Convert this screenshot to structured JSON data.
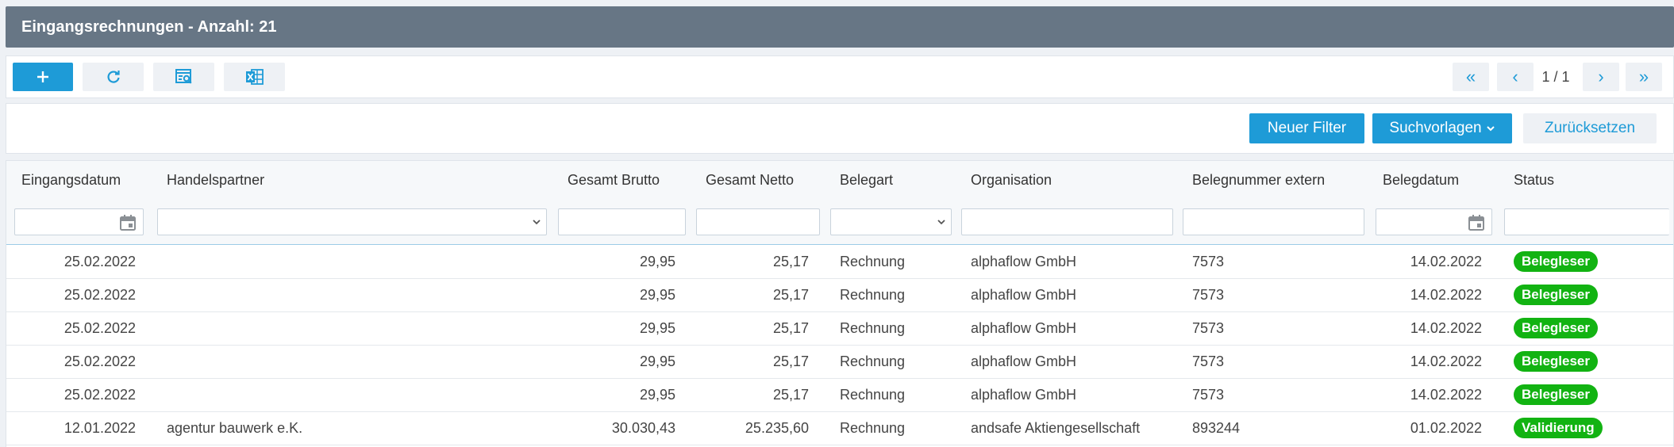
{
  "header": {
    "title": "Eingangsrechnungen - Anzahl: 21"
  },
  "toolbar": {
    "buttons": [
      {
        "name": "add",
        "icon": "plus-icon"
      },
      {
        "name": "refresh",
        "icon": "refresh-icon"
      },
      {
        "name": "search-preview",
        "icon": "search-document-icon"
      },
      {
        "name": "excel-export",
        "icon": "excel-icon"
      }
    ],
    "pager": {
      "first": "«",
      "prev": "‹",
      "label": "1 / 1",
      "next": "›",
      "last": "»"
    }
  },
  "filterbar": {
    "new_filter": "Neuer Filter",
    "templates": "Suchvorlagen",
    "reset": "Zurücksetzen"
  },
  "table": {
    "columns": [
      "Eingangsdatum",
      "Handelspartner",
      "Gesamt Brutto",
      "Gesamt Netto",
      "Belegart",
      "Organisation",
      "Belegnummer extern",
      "Belegdatum",
      "Status"
    ],
    "rows": [
      {
        "eingang": "25.02.2022",
        "partner": "",
        "brutto": "29,95",
        "netto": "25,17",
        "belegart": "Rechnung",
        "org": "alphaflow GmbH",
        "nr": "7573",
        "belegdatum": "14.02.2022",
        "status": "Belegleser"
      },
      {
        "eingang": "25.02.2022",
        "partner": "",
        "brutto": "29,95",
        "netto": "25,17",
        "belegart": "Rechnung",
        "org": "alphaflow GmbH",
        "nr": "7573",
        "belegdatum": "14.02.2022",
        "status": "Belegleser"
      },
      {
        "eingang": "25.02.2022",
        "partner": "",
        "brutto": "29,95",
        "netto": "25,17",
        "belegart": "Rechnung",
        "org": "alphaflow GmbH",
        "nr": "7573",
        "belegdatum": "14.02.2022",
        "status": "Belegleser"
      },
      {
        "eingang": "25.02.2022",
        "partner": "",
        "brutto": "29,95",
        "netto": "25,17",
        "belegart": "Rechnung",
        "org": "alphaflow GmbH",
        "nr": "7573",
        "belegdatum": "14.02.2022",
        "status": "Belegleser"
      },
      {
        "eingang": "25.02.2022",
        "partner": "",
        "brutto": "29,95",
        "netto": "25,17",
        "belegart": "Rechnung",
        "org": "alphaflow GmbH",
        "nr": "7573",
        "belegdatum": "14.02.2022",
        "status": "Belegleser"
      },
      {
        "eingang": "12.01.2022",
        "partner": "agentur bauwerk e.K.",
        "brutto": "30.030,43",
        "netto": "25.235,60",
        "belegart": "Rechnung",
        "org": "andsafe Aktiengesellschaft",
        "nr": "893244",
        "belegdatum": "01.02.2022",
        "status": "Validierung"
      }
    ]
  },
  "colors": {
    "primary": "#1e9bd7",
    "header": "#677685",
    "status_green": "#12b312"
  }
}
